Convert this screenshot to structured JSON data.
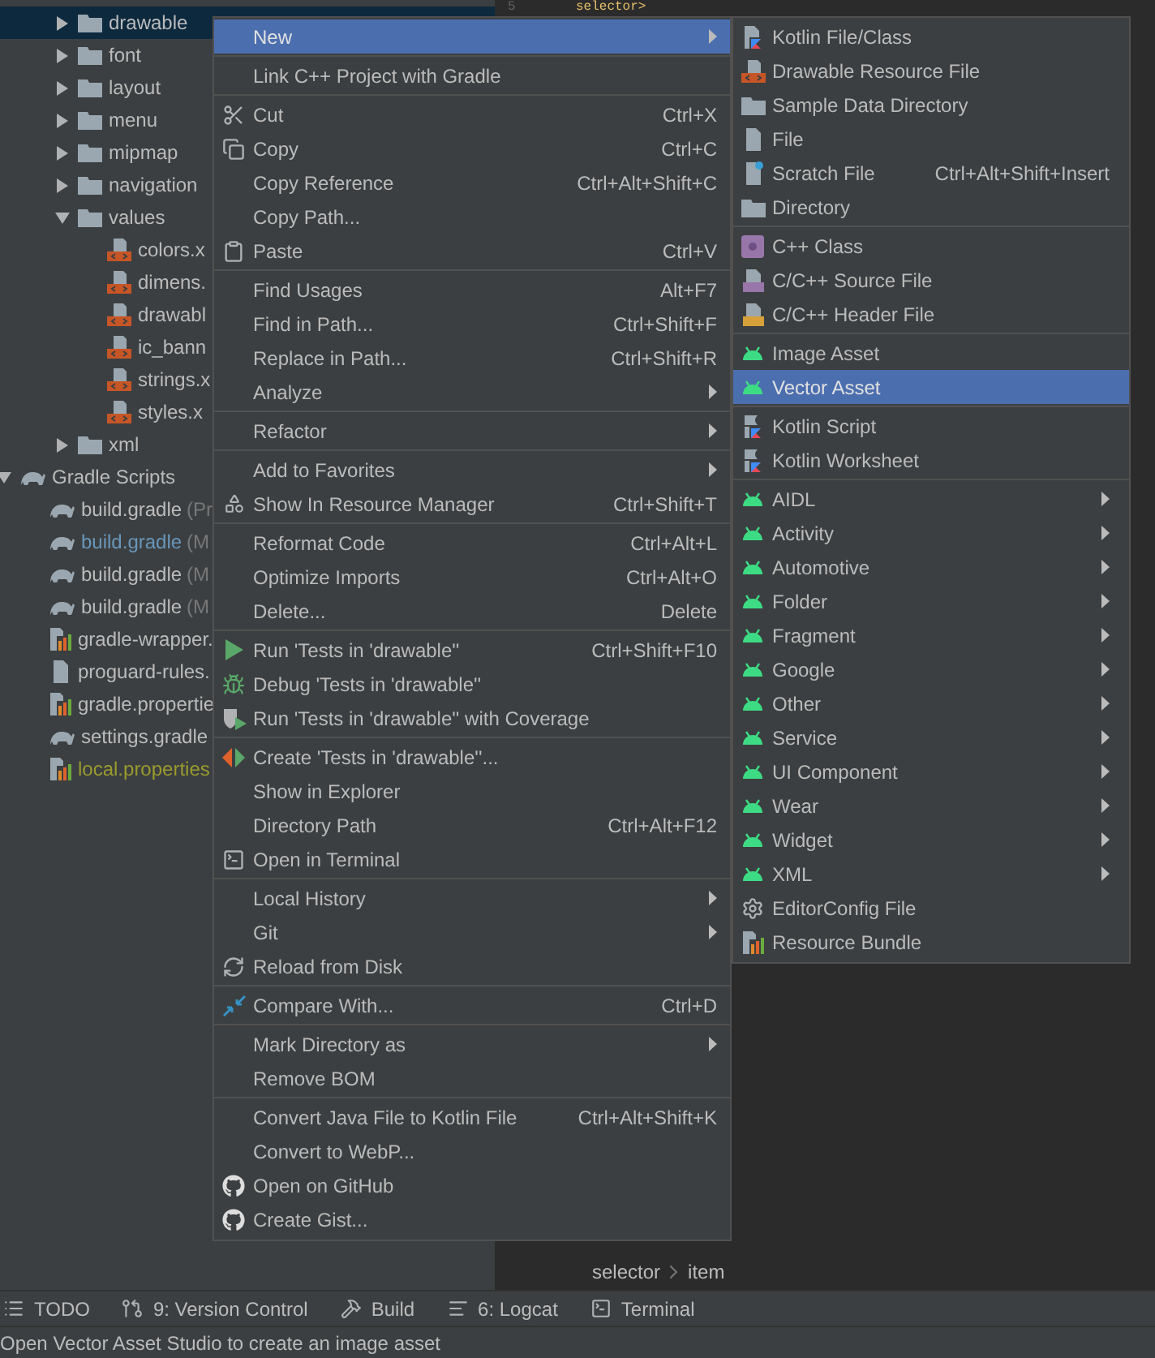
{
  "tree": [
    {
      "children": [
        {
          "children": [
            {
              "label": "drawable",
              "kind": "folder",
              "expanded": false,
              "selected": true
            },
            {
              "label": "font",
              "kind": "folder",
              "expanded": false,
              "selected": false
            },
            {
              "label": "layout",
              "kind": "folder",
              "expanded": false,
              "selected": false
            },
            {
              "label": "menu",
              "kind": "folder",
              "expanded": false,
              "selected": false
            },
            {
              "label": "mipmap",
              "kind": "folder",
              "expanded": false,
              "selected": false
            },
            {
              "label": "navigation",
              "kind": "folder",
              "expanded": false,
              "selected": false
            },
            {
              "label": "values",
              "kind": "folder",
              "expanded": true,
              "selected": false,
              "children": [
                {
                  "label": "colors.x",
                  "kind": "xml",
                  "selected": false
                },
                {
                  "label": "dimens.",
                  "kind": "xml",
                  "selected": false
                },
                {
                  "label": "drawabl",
                  "kind": "xml",
                  "selected": false
                },
                {
                  "label": "ic_bann",
                  "kind": "xml",
                  "selected": false
                },
                {
                  "label": "strings.x",
                  "kind": "xml",
                  "selected": false
                },
                {
                  "label": "styles.x",
                  "kind": "xml",
                  "selected": false
                }
              ]
            },
            {
              "label": "xml",
              "kind": "folder",
              "expanded": false,
              "selected": false
            }
          ]
        }
      ]
    },
    {
      "label": "Gradle Scripts",
      "kind": "gradle",
      "expanded": true,
      "selected": false,
      "children": [
        {
          "label": "build.gradle",
          "note": "(Pr",
          "kind": "gradle",
          "color": "#bbbbbb",
          "selected": false
        },
        {
          "label": "build.gradle",
          "note": "(M",
          "kind": "gradle",
          "color": "#6897bb",
          "selected": false
        },
        {
          "label": "build.gradle",
          "note": "(M",
          "kind": "gradle",
          "color": "#bbbbbb",
          "selected": false
        },
        {
          "label": "build.gradle",
          "note": "(M",
          "kind": "gradle",
          "color": "#bbbbbb",
          "selected": false
        },
        {
          "label": "gradle-wrapper.",
          "kind": "properties",
          "color": "#bbbbbb",
          "selected": false
        },
        {
          "label": "proguard-rules.",
          "kind": "text",
          "color": "#bbbbbb",
          "selected": false
        },
        {
          "label": "gradle.propertie",
          "kind": "properties",
          "color": "#bbbbbb",
          "selected": false
        },
        {
          "label": "settings.gradle",
          "kind": "gradle",
          "color": "#bbbbbb",
          "selected": false
        },
        {
          "label": "local.properties",
          "kind": "properties",
          "color": "#9a9b2c",
          "selected": false
        }
      ]
    }
  ],
  "editor": {
    "line_number": "5",
    "code": "selector>",
    "breadcrumbs": [
      "selector",
      "item"
    ]
  },
  "context_menu": {
    "groups": [
      [
        {
          "label": "New",
          "selected": true,
          "submenu": true
        }
      ],
      [
        {
          "label": "Link C++ Project with Gradle",
          "selected": false
        }
      ],
      [
        {
          "label": "Cut",
          "kind": "cut",
          "shortcut": "Ctrl+X",
          "selected": false
        },
        {
          "label": "Copy",
          "kind": "copy",
          "shortcut": "Ctrl+C",
          "selected": false
        },
        {
          "label": "Copy Reference",
          "shortcut": "Ctrl+Alt+Shift+C",
          "selected": false
        },
        {
          "label": "Copy Path...",
          "selected": false
        },
        {
          "label": "Paste",
          "kind": "paste",
          "shortcut": "Ctrl+V",
          "selected": false
        }
      ],
      [
        {
          "label": "Find Usages",
          "shortcut": "Alt+F7",
          "selected": false
        },
        {
          "label": "Find in Path...",
          "shortcut": "Ctrl+Shift+F",
          "selected": false
        },
        {
          "label": "Replace in Path...",
          "shortcut": "Ctrl+Shift+R",
          "selected": false
        },
        {
          "label": "Analyze",
          "selected": false,
          "submenu": true
        }
      ],
      [
        {
          "label": "Refactor",
          "selected": false,
          "submenu": true
        }
      ],
      [
        {
          "label": "Add to Favorites",
          "selected": false,
          "submenu": true
        },
        {
          "label": "Show In Resource Manager",
          "kind": "resources",
          "shortcut": "Ctrl+Shift+T",
          "selected": false
        }
      ],
      [
        {
          "label": "Reformat Code",
          "shortcut": "Ctrl+Alt+L",
          "selected": false
        },
        {
          "label": "Optimize Imports",
          "shortcut": "Ctrl+Alt+O",
          "selected": false
        },
        {
          "label": "Delete...",
          "shortcut": "Delete",
          "selected": false
        }
      ],
      [
        {
          "label": "Run 'Tests in 'drawable''",
          "kind": "run",
          "shortcut": "Ctrl+Shift+F10",
          "selected": false
        },
        {
          "label": "Debug 'Tests in 'drawable''",
          "kind": "debug",
          "selected": false
        },
        {
          "label": "Run 'Tests in 'drawable'' with Coverage",
          "kind": "coverage",
          "selected": false
        }
      ],
      [
        {
          "label": "Create 'Tests in 'drawable''...",
          "kind": "test",
          "selected": false
        },
        {
          "label": "Show in Explorer",
          "selected": false
        },
        {
          "label": "Directory Path",
          "shortcut": "Ctrl+Alt+F12",
          "selected": false
        },
        {
          "label": "Open in Terminal",
          "kind": "terminal",
          "selected": false
        }
      ],
      [
        {
          "label": "Local History",
          "selected": false,
          "submenu": true
        },
        {
          "label": "Git",
          "selected": false,
          "submenu": true
        },
        {
          "label": "Reload from Disk",
          "kind": "reload",
          "selected": false
        }
      ],
      [
        {
          "label": "Compare With...",
          "kind": "compare",
          "shortcut": "Ctrl+D",
          "selected": false
        }
      ],
      [
        {
          "label": "Mark Directory as",
          "selected": false,
          "submenu": true
        },
        {
          "label": "Remove BOM",
          "selected": false
        }
      ],
      [
        {
          "label": "Convert Java File to Kotlin File",
          "shortcut": "Ctrl+Alt+Shift+K",
          "selected": false
        },
        {
          "label": "Convert to WebP...",
          "selected": false
        },
        {
          "label": "Open on GitHub",
          "kind": "github",
          "selected": false
        },
        {
          "label": "Create Gist...",
          "kind": "github",
          "selected": false
        }
      ]
    ]
  },
  "new_submenu": {
    "groups": [
      [
        {
          "label": "Kotlin File/Class",
          "kind": "kotlin",
          "selected": false
        },
        {
          "label": "Drawable Resource File",
          "kind": "xml",
          "selected": false
        },
        {
          "label": "Sample Data Directory",
          "kind": "folder",
          "selected": false
        },
        {
          "label": "File",
          "kind": "file",
          "selected": false
        },
        {
          "label": "Scratch File",
          "kind": "scratch",
          "shortcut": "Ctrl+Alt+Shift+Insert",
          "selected": false
        },
        {
          "label": "Directory",
          "kind": "folder",
          "selected": false
        }
      ],
      [
        {
          "label": "C++ Class",
          "kind": "cppclass",
          "selected": false
        },
        {
          "label": "C/C++ Source File",
          "kind": "cppsource",
          "selected": false
        },
        {
          "label": "C/C++ Header File",
          "kind": "cppheader",
          "selected": false
        }
      ],
      [
        {
          "label": "Image Asset",
          "kind": "android",
          "selected": false
        },
        {
          "label": "Vector Asset",
          "kind": "android",
          "selected": true
        }
      ],
      [
        {
          "label": "Kotlin Script",
          "kind": "kotlinscript",
          "selected": false
        },
        {
          "label": "Kotlin Worksheet",
          "kind": "kotlinscript",
          "selected": false
        }
      ],
      [
        {
          "label": "AIDL",
          "kind": "android",
          "selected": false,
          "submenu": true
        },
        {
          "label": "Activity",
          "kind": "android",
          "selected": false,
          "submenu": true
        },
        {
          "label": "Automotive",
          "kind": "android",
          "selected": false,
          "submenu": true
        },
        {
          "label": "Folder",
          "kind": "android",
          "selected": false,
          "submenu": true
        },
        {
          "label": "Fragment",
          "kind": "android",
          "selected": false,
          "submenu": true
        },
        {
          "label": "Google",
          "kind": "android",
          "selected": false,
          "submenu": true
        },
        {
          "label": "Other",
          "kind": "android",
          "selected": false,
          "submenu": true
        },
        {
          "label": "Service",
          "kind": "android",
          "selected": false,
          "submenu": true
        },
        {
          "label": "UI Component",
          "kind": "android",
          "selected": false,
          "submenu": true
        },
        {
          "label": "Wear",
          "kind": "android",
          "selected": false,
          "submenu": true
        },
        {
          "label": "Widget",
          "kind": "android",
          "selected": false,
          "submenu": true
        },
        {
          "label": "XML",
          "kind": "android",
          "selected": false,
          "submenu": true
        },
        {
          "label": "EditorConfig File",
          "kind": "gear",
          "selected": false
        },
        {
          "label": "Resource Bundle",
          "kind": "bundle",
          "selected": false
        }
      ]
    ]
  },
  "tool_windows": [
    {
      "label": "TODO",
      "kind": "list"
    },
    {
      "label": "9: Version Control",
      "kind": "vcs"
    },
    {
      "label": "Build",
      "kind": "build"
    },
    {
      "label": "6: Logcat",
      "kind": "logcat"
    },
    {
      "label": "Terminal",
      "kind": "terminal"
    }
  ],
  "status_bar": {
    "message": "Open Vector Asset Studio to create an image asset"
  }
}
